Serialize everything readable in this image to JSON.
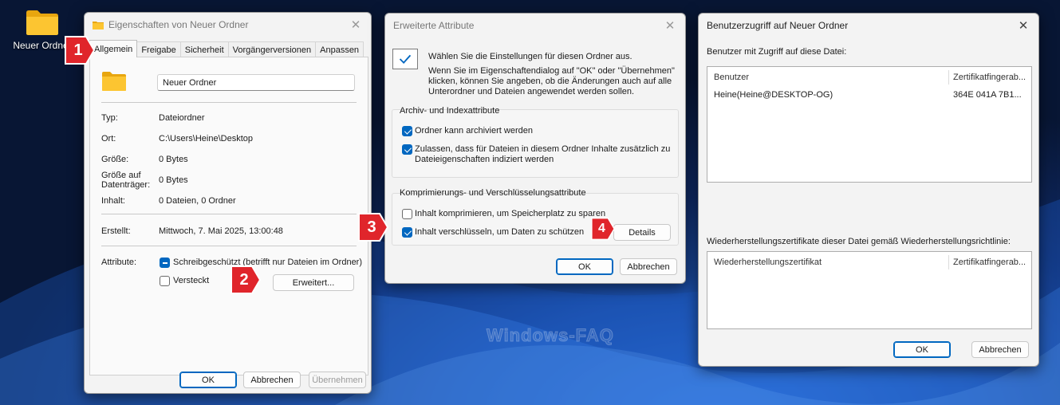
{
  "desktop": {
    "folder_label": "Neuer Ordner",
    "watermark": "Windows-FAQ"
  },
  "properties": {
    "title": "Eigenschaften von Neuer Ordner",
    "tabs": [
      "Allgemein",
      "Freigabe",
      "Sicherheit",
      "Vorgängerversionen",
      "Anpassen"
    ],
    "folder_name": "Neuer Ordner",
    "fields": {
      "typ_label": "Typ:",
      "typ_value": "Dateiordner",
      "ort_label": "Ort:",
      "ort_value": "C:\\Users\\Heine\\Desktop",
      "groesse_label": "Größe:",
      "groesse_value": "0 Bytes",
      "groesse_dt_label_1": "Größe auf",
      "groesse_dt_label_2": "Datenträger:",
      "groesse_dt_value": "0 Bytes",
      "inhalt_label": "Inhalt:",
      "inhalt_value": "0 Dateien, 0 Ordner",
      "erstellt_label": "Erstellt:",
      "erstellt_value": "Mittwoch, 7. Mai 2025, 13:00:48",
      "attribute_label": "Attribute:"
    },
    "readonly_label": "Schreibgeschützt (betrifft nur Dateien im Ordner)",
    "hidden_label": "Versteckt",
    "advanced_button": "Erweitert...",
    "ok": "OK",
    "cancel": "Abbrechen",
    "apply": "Übernehmen"
  },
  "advanced": {
    "title": "Erweiterte Attribute",
    "intro_1": "Wählen Sie die Einstellungen für diesen Ordner aus.",
    "intro_2": "Wenn Sie im Eigenschaftendialog auf \"OK\" oder \"Übernehmen\"",
    "intro_3": "klicken, können Sie angeben, ob die Änderungen auch auf alle",
    "intro_4": "Unterordner und Dateien angewendet werden sollen.",
    "archive_group": "Archiv- und Indexattribute",
    "archive_chk": "Ordner kann archiviert werden",
    "index_chk_1": "Zulassen, dass für Dateien in diesem Ordner Inhalte zusätzlich zu",
    "index_chk_2": "Dateieigenschaften indiziert werden",
    "compress_group": "Komprimierungs- und Verschlüsselungsattribute",
    "compress_chk": "Inhalt komprimieren, um Speicherplatz zu sparen",
    "encrypt_chk": "Inhalt verschlüsseln, um Daten zu schützen",
    "details": "Details",
    "ok": "OK",
    "cancel": "Abbrechen"
  },
  "access": {
    "title": "Benutzerzugriff auf Neuer Ordner",
    "users_label": "Benutzer mit Zugriff auf diese Datei:",
    "col_user": "Benutzer",
    "col_cert": "Zertifikatfingerab...",
    "user_name": "Heine(Heine@DESKTOP-OG)",
    "user_cert": "364E 041A 7B1...",
    "recovery_label": "Wiederherstellungszertifikate dieser Datei gemäß Wiederherstellungsrichtlinie:",
    "col_recovery": "Wiederherstellungszertifikat",
    "col_recovery_cert": "Zertifikatfingerab...",
    "ok": "OK",
    "cancel": "Abbrechen"
  },
  "badges": [
    "1",
    "2",
    "3",
    "4"
  ],
  "colors": {
    "accent": "#0067c0",
    "badge": "#e0252b",
    "desktop_bg": "#0f2a66"
  }
}
